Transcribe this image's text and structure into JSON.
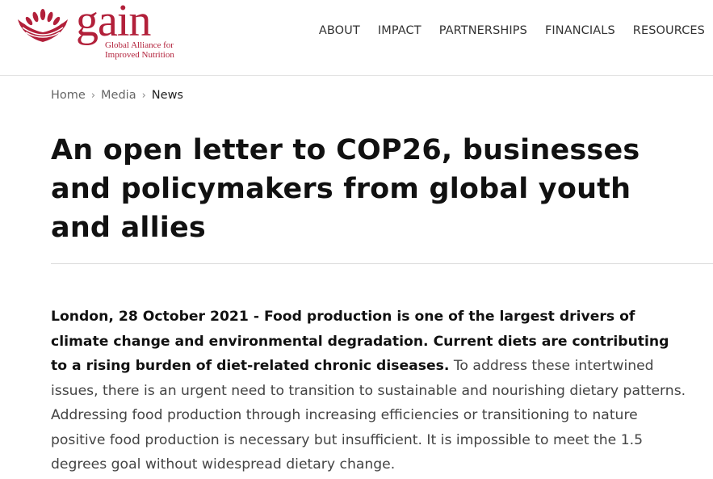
{
  "logo": {
    "wordmark": "gain",
    "subtitle_line1": "Global Alliance for",
    "subtitle_line2": "Improved Nutrition",
    "brand_color": "#b2203a"
  },
  "nav": {
    "items": [
      {
        "label": "ABOUT"
      },
      {
        "label": "IMPACT"
      },
      {
        "label": "PARTNERSHIPS"
      },
      {
        "label": "FINANCIALS"
      },
      {
        "label": "RESOURCES"
      }
    ]
  },
  "breadcrumb": {
    "items": [
      {
        "label": "Home"
      },
      {
        "label": "Media"
      },
      {
        "label": "News"
      }
    ]
  },
  "article": {
    "title": "An open letter to COP26, businesses and policymakers from global youth and allies",
    "lead": "London, 28 October 2021 - Food production is one of the largest drivers of climate change and environmental degradation. Current diets are contributing to a rising burden of diet-related chronic diseases.",
    "body": " To address these intertwined issues, there is an urgent need to transition to sustainable and nourishing dietary patterns. Addressing food production through increasing efficiencies or transitioning to nature positive food production is necessary but insufficient. It is impossible to meet the 1.5 degrees goal without widespread dietary change."
  }
}
